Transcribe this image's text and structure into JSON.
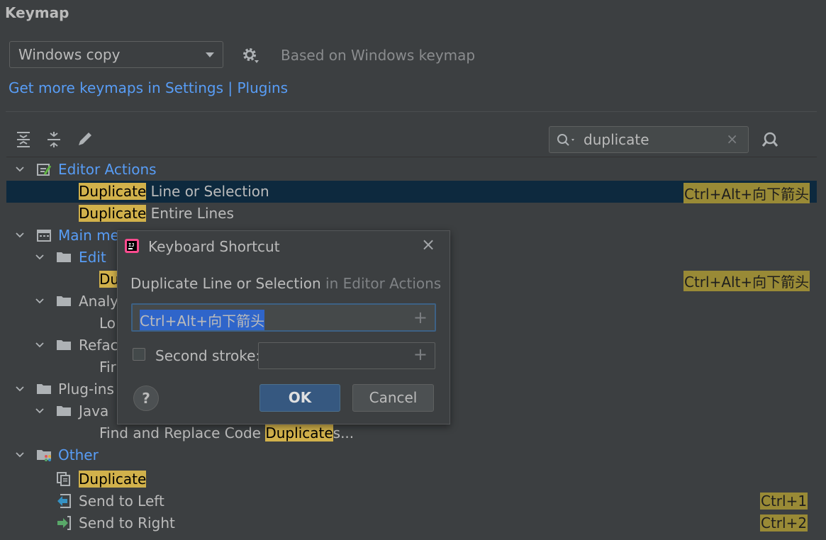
{
  "title": "Keymap",
  "keymap": {
    "selected": "Windows copy",
    "based_on": "Based on Windows keymap"
  },
  "links": {
    "text": "Get more keymaps in Settings | Plugins"
  },
  "search": {
    "value": "duplicate"
  },
  "tree": {
    "editor_actions": "Editor Actions",
    "dup_line_hl": "Duplicate",
    "dup_line_rest": " Line or Selection",
    "dup_line_shortcut": "Ctrl+Alt+向下箭头",
    "dup_entire_hl": "Duplicate",
    "dup_entire_rest": " Entire Lines",
    "main_menu": "Main me",
    "edit": "Edit",
    "edit_item_hl": "Du",
    "edit_item_shortcut": "Ctrl+Alt+向下箭头",
    "analyze": "Analy",
    "analyze_item": "Lo",
    "refactor": "Refac",
    "refactor_item": "Fir",
    "plugins": "Plug-ins",
    "java": "Java",
    "find_replace_pre": "Find and Replace Code ",
    "find_replace_hl": "Duplicate",
    "find_replace_post": "s...",
    "other": "Other",
    "other_dup_hl": "Duplicate",
    "send_left": "Send to Left",
    "send_left_shortcut": "Ctrl+1",
    "send_right": "Send to Right",
    "send_right_shortcut": "Ctrl+2"
  },
  "dialog": {
    "title": "Keyboard Shortcut",
    "action": "Duplicate Line or Selection",
    "context": "in Editor Actions",
    "shortcut": "Ctrl+Alt+向下箭头",
    "second_stroke": "Second stroke:",
    "help": "?",
    "ok": "OK",
    "cancel": "Cancel"
  }
}
